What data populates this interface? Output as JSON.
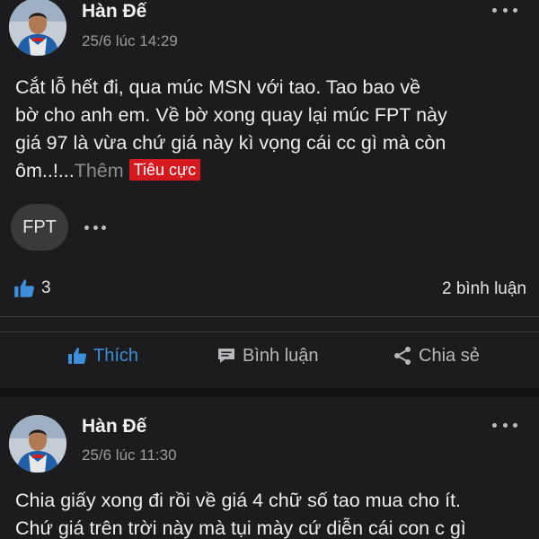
{
  "colors": {
    "background": "#1c1c1e",
    "accent": "#3d8fd9",
    "sentiment_badge": "#d6191f"
  },
  "posts": [
    {
      "author": "Hàn Đế",
      "time": "25/6 lúc 14:29",
      "lines": [
        "Cắt lỗ hết đi, qua múc MSN với tao. Tao bao về",
        "bờ cho anh em. Về bờ xong quay lại múc FPT này",
        "giá 97 là vừa chứ giá này kì vọng cái cc gì mà còn",
        "ôm..!..."
      ],
      "see_more": "Thêm",
      "sentiment": "Tiêu cực",
      "ticker": "FPT",
      "likes": "3",
      "comments": "2 bình luận",
      "actions": {
        "like": "Thích",
        "comment": "Bình luận",
        "share": "Chia sẻ"
      }
    },
    {
      "author": "Hàn Đế",
      "time": "25/6 lúc 11:30",
      "lines": [
        "Chia giấy xong đi rồi về giá 4 chữ số tao mua cho ít.",
        "Chứ giá trên trời này mà tụi mày cứ diễn cái con c gì"
      ]
    }
  ],
  "icons": {
    "more": "more-horizontal-icon",
    "like": "thumbs-up-icon",
    "comment": "comment-bubble-icon",
    "share": "share-icon"
  }
}
